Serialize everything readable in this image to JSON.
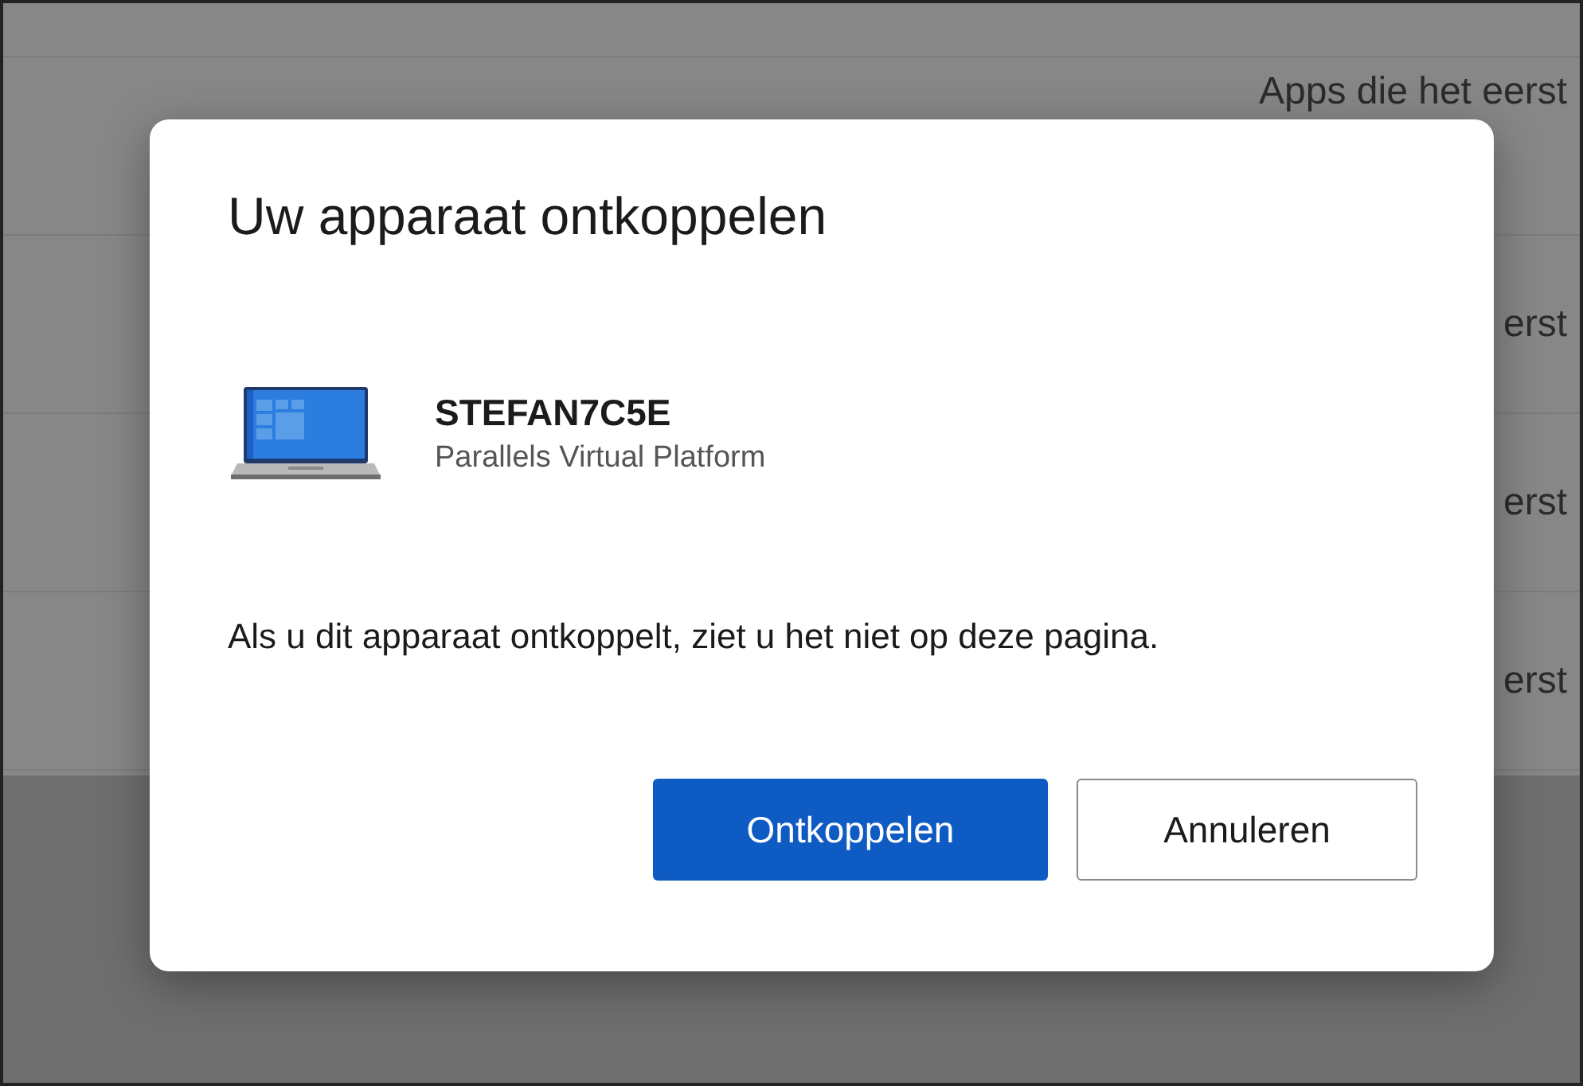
{
  "background_rows": [
    {
      "text": "Apps die het eerst"
    },
    {
      "text": "erst"
    },
    {
      "text": "erst"
    },
    {
      "text": "erst"
    }
  ],
  "dialog": {
    "title": "Uw apparaat ontkoppelen",
    "device": {
      "name": "STEFAN7C5E",
      "model": "Parallels Virtual Platform"
    },
    "message": "Als u dit apparaat ontkoppelt, ziet u het niet op deze pagina.",
    "buttons": [
      {
        "label": "Ontkoppelen",
        "kind": "primary"
      },
      {
        "label": "Annuleren",
        "kind": "secondary"
      }
    ]
  }
}
